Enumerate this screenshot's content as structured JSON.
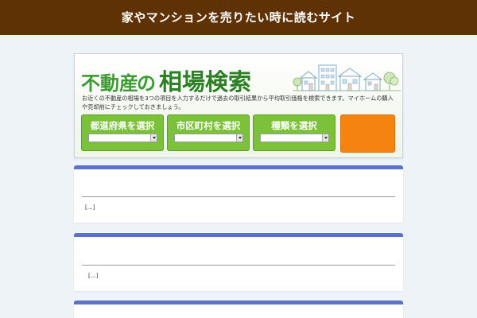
{
  "header": {
    "title": "家やマンションを売りたい時に読むサイト"
  },
  "widget": {
    "title_part1": "不動産",
    "title_part2": "の",
    "title_part3": "相場検索",
    "description": "お近くの不動産の相場を3つの項目を入力するだけで過去の取引結果から平均取引価格を検索できます。マイホームの購入や売却前にチェックしておきましょう。",
    "selectors": [
      {
        "label": "都道府県を選択",
        "value": ""
      },
      {
        "label": "市区町村を選択",
        "value": ""
      },
      {
        "label": "種類を選択",
        "value": ""
      }
    ],
    "search_label": ""
  },
  "articles": [
    {
      "title": "",
      "excerpt": "[…]"
    },
    {
      "title": "",
      "excerpt": "[…]"
    },
    {
      "title": "",
      "excerpt": ""
    }
  ],
  "colors": {
    "header_bg": "#5e3204",
    "page_bg": "#eef3f8",
    "select_green": "#7cc13a",
    "search_orange": "#f5830f",
    "card_accent": "#5a72c7",
    "title_green": "#3c9b33"
  }
}
